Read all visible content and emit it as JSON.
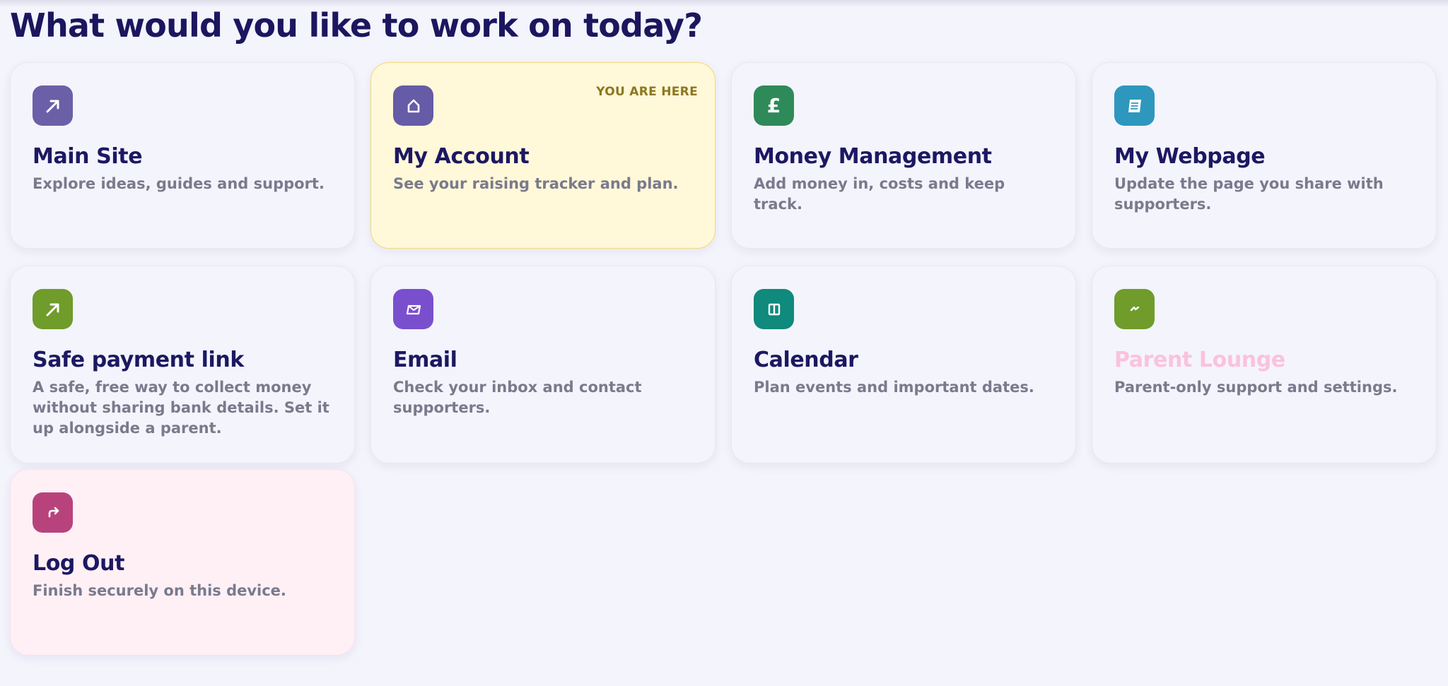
{
  "page": {
    "title": "What would you like to work on today?"
  },
  "colors": {
    "background": "#f4f4fd",
    "title": "#1b165e",
    "current_card": "#fff8d9",
    "logout_card": "#fff0f6"
  },
  "cards": [
    {
      "title": "Main Site",
      "description": "Explore ideas, guides and support.",
      "icon": "arrow-up-right-icon",
      "icon_color": "#6b5fa8"
    },
    {
      "title": "My Account",
      "description": "See your raising tracker and plan.",
      "icon": "home-icon",
      "icon_color": "#665ba6",
      "badge": "YOU ARE HERE",
      "current": true
    },
    {
      "title": "Money Management",
      "description": "Add money in, costs and keep track.",
      "icon": "pound-icon",
      "icon_color": "#2f8a5a",
      "glyph": "£"
    },
    {
      "title": "My Webpage",
      "description": "Update the page you share with supporters.",
      "icon": "webpage-icon",
      "icon_color": "#2e97bd"
    },
    {
      "title": "Safe payment link",
      "description": "A safe, free way to collect money without sharing bank details. Set it up alongside a parent.",
      "icon": "arrow-up-right-icon",
      "icon_color": "#6f9c2a"
    },
    {
      "title": "Email",
      "description": "Check your inbox and contact supporters.",
      "icon": "envelope-icon",
      "icon_color": "#7a4fce"
    },
    {
      "title": "Calendar",
      "description": "Plan events and important dates.",
      "icon": "calendar-icon",
      "icon_color": "#0f8a7c"
    },
    {
      "title": "Parent Lounge",
      "description": "Parent-only support and settings.",
      "icon": "parent-icon",
      "icon_color": "#6f9c2a",
      "muted": true
    },
    {
      "title": "Log Out",
      "description": "Finish securely on this device.",
      "icon": "logout-icon",
      "icon_color": "#b8437c"
    }
  ]
}
